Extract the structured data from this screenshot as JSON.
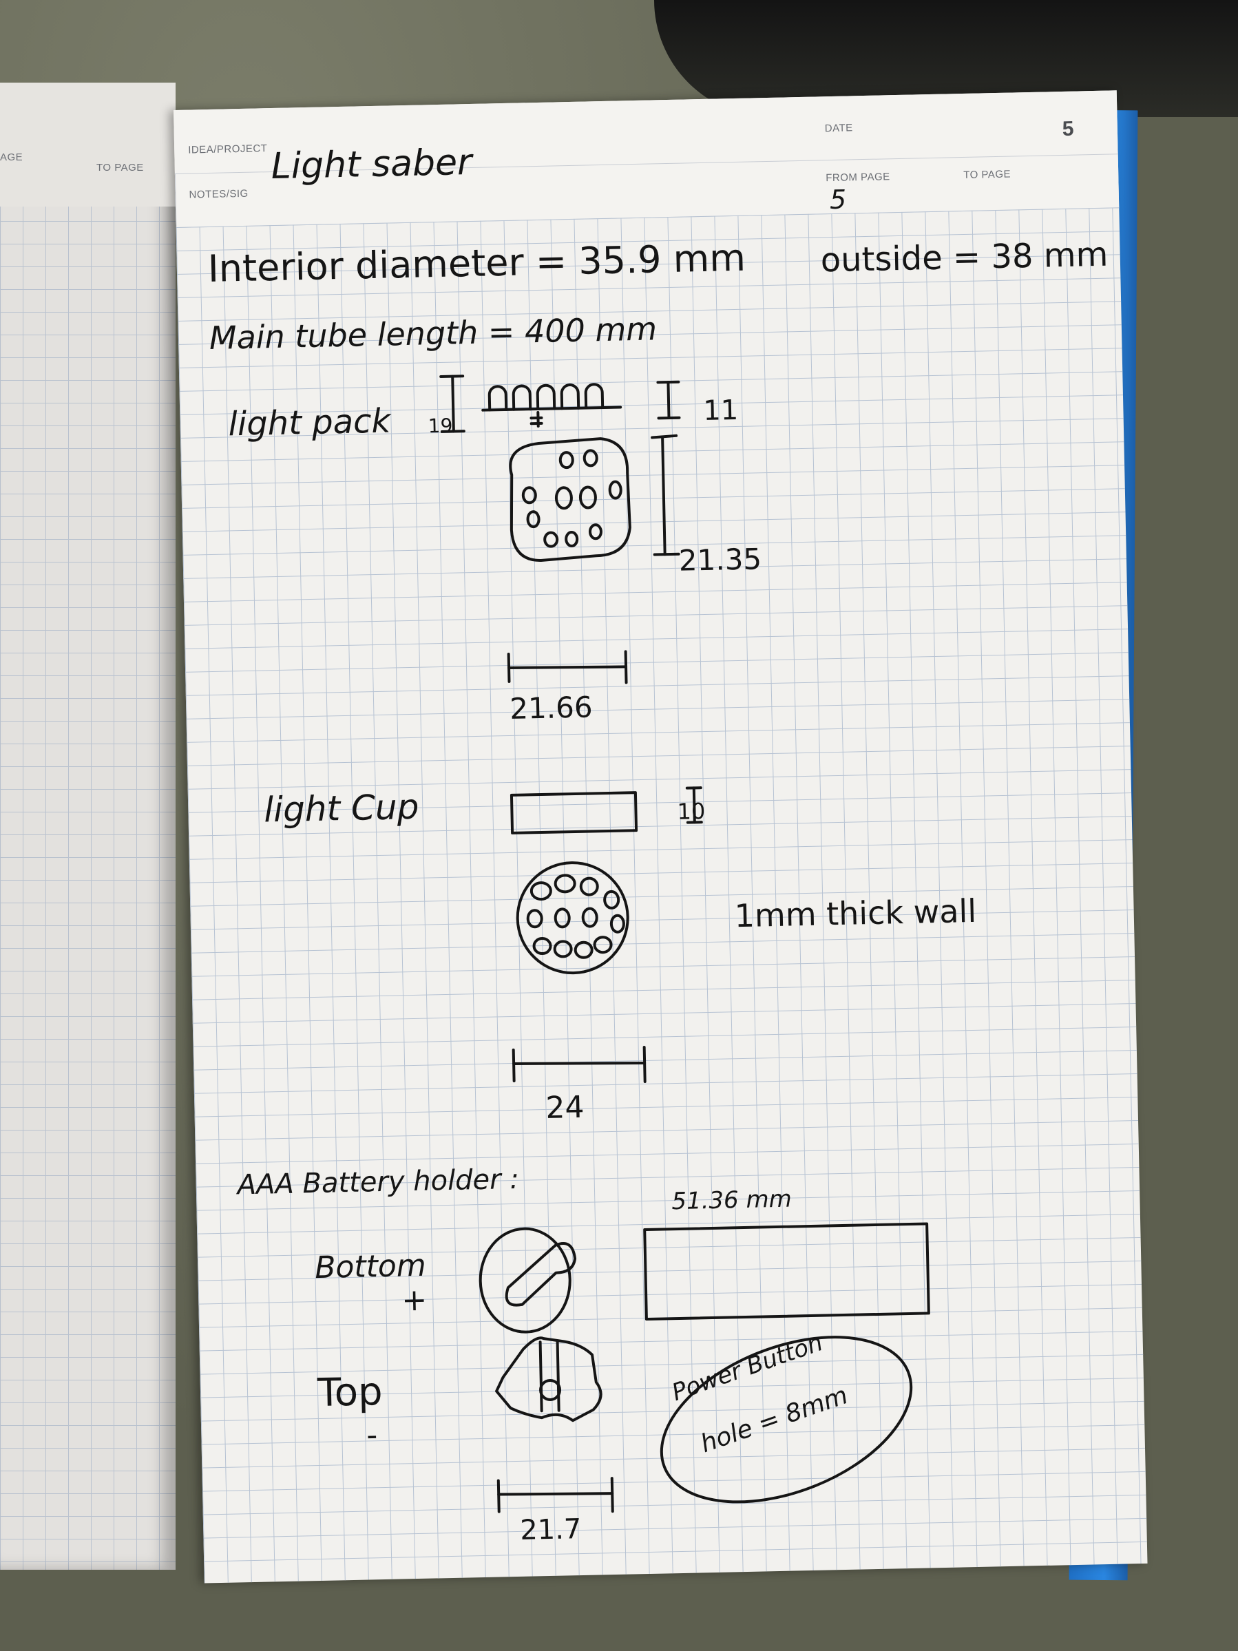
{
  "left_page": {
    "page_label_fragment": "AGE",
    "to_page_label": "TO PAGE"
  },
  "header": {
    "idea_project_label": "IDEA/PROJECT",
    "notes_sig_label": "NOTES/SIG",
    "project_title": "Light saber",
    "date_label": "DATE",
    "page_number": "5",
    "from_page_label": "FROM PAGE",
    "from_page_value": "5",
    "to_page_label": "TO PAGE"
  },
  "notes": {
    "interior_diameter": "Interior diameter = 35.9 mm",
    "outside": "outside = 38 mm",
    "main_tube": "Main tube length = 400 mm",
    "light_pack_label": "light pack",
    "light_pack_height_left": "19",
    "light_pack_height_right": "11",
    "light_pack_side": "21.35",
    "light_pack_width": "21.66",
    "light_cup_label": "light Cup",
    "light_cup_height": "10",
    "wall_note": "1mm thick wall",
    "light_cup_width": "24",
    "battery_holder": "AAA Battery holder :",
    "bottom_label": "Bottom",
    "bottom_sign": "+",
    "holder_length": "51.36 mm",
    "top_label": "Top",
    "top_sign": "-",
    "power_button": "Power Button",
    "hole_size": "hole = 8mm",
    "holder_width": "21.7"
  },
  "colors": {
    "paper": "#f2f1ee",
    "grid": "#b7c3d3",
    "ink": "#151515",
    "cover_blue": "#2a86e0",
    "carpet": "#5f6152"
  }
}
